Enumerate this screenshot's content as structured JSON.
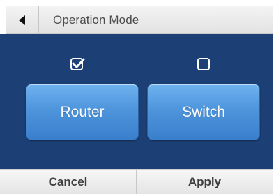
{
  "header": {
    "back_icon": "back-arrow-icon",
    "title": "Operation Mode"
  },
  "modes": [
    {
      "label": "Router",
      "checked": true
    },
    {
      "label": "Switch",
      "checked": false
    }
  ],
  "footer": {
    "cancel_label": "Cancel",
    "apply_label": "Apply"
  },
  "colors": {
    "panel_background": "#1c4076",
    "button_blue": "#4e95dc",
    "header_background": "#e8e8e8"
  }
}
